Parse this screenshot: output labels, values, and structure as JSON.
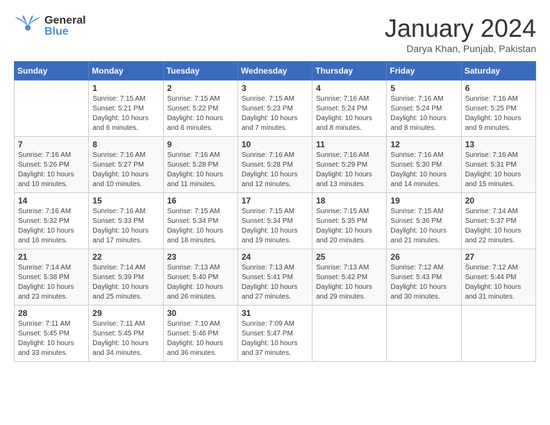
{
  "header": {
    "logo_general": "General",
    "logo_blue": "Blue",
    "month_title": "January 2024",
    "location": "Darya Khan, Punjab, Pakistan"
  },
  "calendar": {
    "days_of_week": [
      "Sunday",
      "Monday",
      "Tuesday",
      "Wednesday",
      "Thursday",
      "Friday",
      "Saturday"
    ],
    "weeks": [
      [
        {
          "day": "",
          "info": ""
        },
        {
          "day": "1",
          "info": "Sunrise: 7:15 AM\nSunset: 5:21 PM\nDaylight: 10 hours\nand 6 minutes."
        },
        {
          "day": "2",
          "info": "Sunrise: 7:15 AM\nSunset: 5:22 PM\nDaylight: 10 hours\nand 6 minutes."
        },
        {
          "day": "3",
          "info": "Sunrise: 7:15 AM\nSunset: 5:23 PM\nDaylight: 10 hours\nand 7 minutes."
        },
        {
          "day": "4",
          "info": "Sunrise: 7:16 AM\nSunset: 5:24 PM\nDaylight: 10 hours\nand 8 minutes."
        },
        {
          "day": "5",
          "info": "Sunrise: 7:16 AM\nSunset: 5:24 PM\nDaylight: 10 hours\nand 8 minutes."
        },
        {
          "day": "6",
          "info": "Sunrise: 7:16 AM\nSunset: 5:25 PM\nDaylight: 10 hours\nand 9 minutes."
        }
      ],
      [
        {
          "day": "7",
          "info": "Sunrise: 7:16 AM\nSunset: 5:26 PM\nDaylight: 10 hours\nand 10 minutes."
        },
        {
          "day": "8",
          "info": "Sunrise: 7:16 AM\nSunset: 5:27 PM\nDaylight: 10 hours\nand 10 minutes."
        },
        {
          "day": "9",
          "info": "Sunrise: 7:16 AM\nSunset: 5:28 PM\nDaylight: 10 hours\nand 11 minutes."
        },
        {
          "day": "10",
          "info": "Sunrise: 7:16 AM\nSunset: 5:28 PM\nDaylight: 10 hours\nand 12 minutes."
        },
        {
          "day": "11",
          "info": "Sunrise: 7:16 AM\nSunset: 5:29 PM\nDaylight: 10 hours\nand 13 minutes."
        },
        {
          "day": "12",
          "info": "Sunrise: 7:16 AM\nSunset: 5:30 PM\nDaylight: 10 hours\nand 14 minutes."
        },
        {
          "day": "13",
          "info": "Sunrise: 7:16 AM\nSunset: 5:31 PM\nDaylight: 10 hours\nand 15 minutes."
        }
      ],
      [
        {
          "day": "14",
          "info": "Sunrise: 7:16 AM\nSunset: 5:32 PM\nDaylight: 10 hours\nand 16 minutes."
        },
        {
          "day": "15",
          "info": "Sunrise: 7:16 AM\nSunset: 5:33 PM\nDaylight: 10 hours\nand 17 minutes."
        },
        {
          "day": "16",
          "info": "Sunrise: 7:15 AM\nSunset: 5:34 PM\nDaylight: 10 hours\nand 18 minutes."
        },
        {
          "day": "17",
          "info": "Sunrise: 7:15 AM\nSunset: 5:34 PM\nDaylight: 10 hours\nand 19 minutes."
        },
        {
          "day": "18",
          "info": "Sunrise: 7:15 AM\nSunset: 5:35 PM\nDaylight: 10 hours\nand 20 minutes."
        },
        {
          "day": "19",
          "info": "Sunrise: 7:15 AM\nSunset: 5:36 PM\nDaylight: 10 hours\nand 21 minutes."
        },
        {
          "day": "20",
          "info": "Sunrise: 7:14 AM\nSunset: 5:37 PM\nDaylight: 10 hours\nand 22 minutes."
        }
      ],
      [
        {
          "day": "21",
          "info": "Sunrise: 7:14 AM\nSunset: 5:38 PM\nDaylight: 10 hours\nand 23 minutes."
        },
        {
          "day": "22",
          "info": "Sunrise: 7:14 AM\nSunset: 5:39 PM\nDaylight: 10 hours\nand 25 minutes."
        },
        {
          "day": "23",
          "info": "Sunrise: 7:13 AM\nSunset: 5:40 PM\nDaylight: 10 hours\nand 26 minutes."
        },
        {
          "day": "24",
          "info": "Sunrise: 7:13 AM\nSunset: 5:41 PM\nDaylight: 10 hours\nand 27 minutes."
        },
        {
          "day": "25",
          "info": "Sunrise: 7:13 AM\nSunset: 5:42 PM\nDaylight: 10 hours\nand 29 minutes."
        },
        {
          "day": "26",
          "info": "Sunrise: 7:12 AM\nSunset: 5:43 PM\nDaylight: 10 hours\nand 30 minutes."
        },
        {
          "day": "27",
          "info": "Sunrise: 7:12 AM\nSunset: 5:44 PM\nDaylight: 10 hours\nand 31 minutes."
        }
      ],
      [
        {
          "day": "28",
          "info": "Sunrise: 7:11 AM\nSunset: 5:45 PM\nDaylight: 10 hours\nand 33 minutes."
        },
        {
          "day": "29",
          "info": "Sunrise: 7:11 AM\nSunset: 5:45 PM\nDaylight: 10 hours\nand 34 minutes."
        },
        {
          "day": "30",
          "info": "Sunrise: 7:10 AM\nSunset: 5:46 PM\nDaylight: 10 hours\nand 36 minutes."
        },
        {
          "day": "31",
          "info": "Sunrise: 7:09 AM\nSunset: 5:47 PM\nDaylight: 10 hours\nand 37 minutes."
        },
        {
          "day": "",
          "info": ""
        },
        {
          "day": "",
          "info": ""
        },
        {
          "day": "",
          "info": ""
        }
      ]
    ]
  }
}
